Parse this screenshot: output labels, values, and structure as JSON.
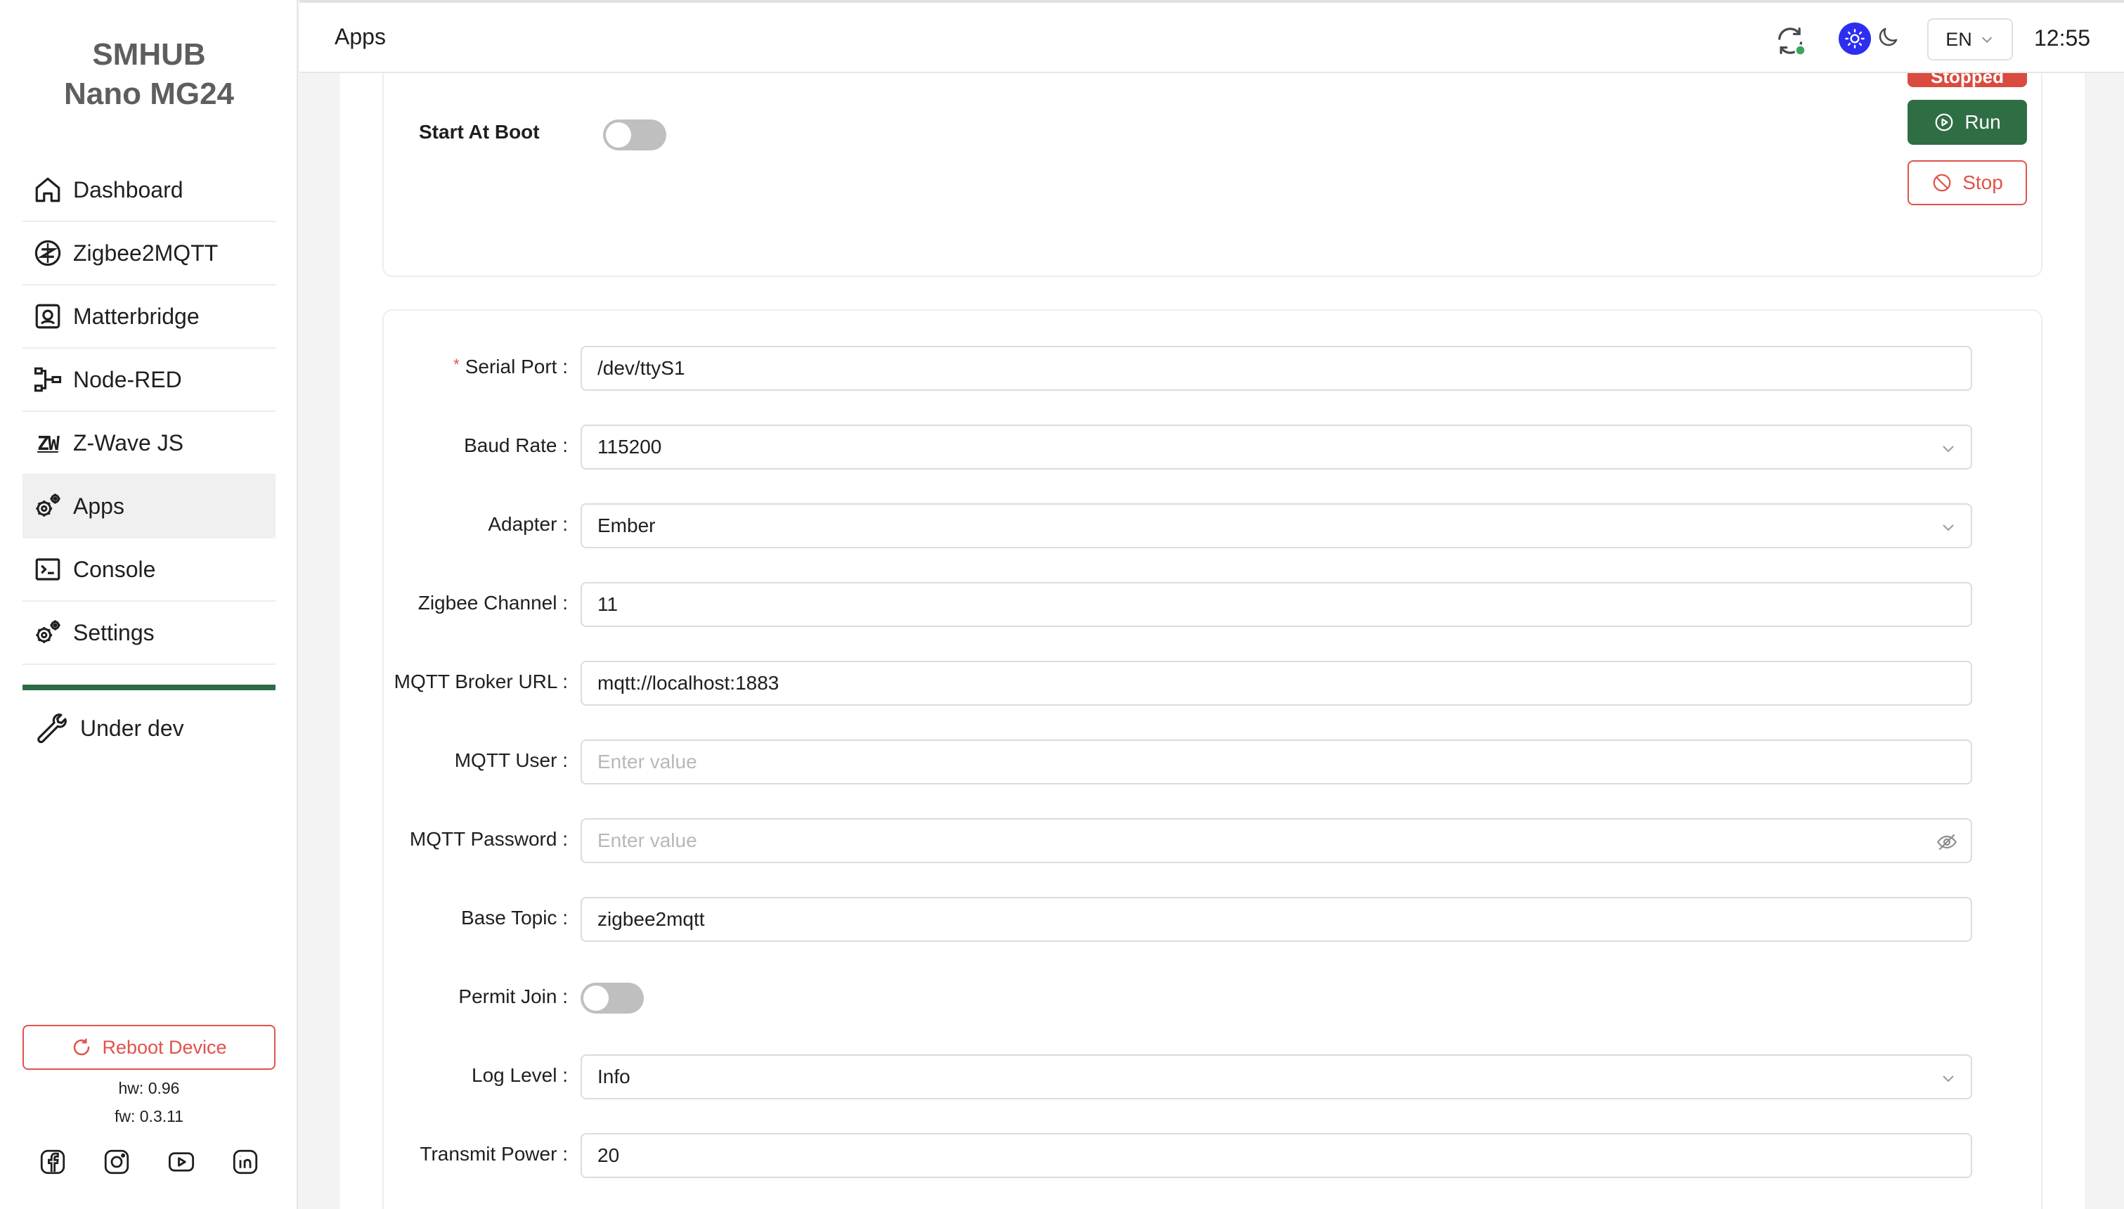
{
  "brand": {
    "line1": "SMHUB",
    "line2": "Nano MG24"
  },
  "sidebar": {
    "items": [
      {
        "label": "Dashboard",
        "icon": "home-icon"
      },
      {
        "label": "Zigbee2MQTT",
        "icon": "zigbee-icon"
      },
      {
        "label": "Matterbridge",
        "icon": "matter-icon"
      },
      {
        "label": "Node-RED",
        "icon": "node-red-icon"
      },
      {
        "label": "Z-Wave JS",
        "icon": "zwave-icon",
        "glyph": "ZW"
      },
      {
        "label": "Apps",
        "icon": "gears-icon",
        "active": true
      },
      {
        "label": "Console",
        "icon": "terminal-icon"
      },
      {
        "label": "Settings",
        "icon": "gears-icon"
      }
    ],
    "under_dev": "Under dev",
    "reboot_label": "Reboot Device",
    "hw": "hw: 0.96",
    "fw": "fw: 0.3.11",
    "social": [
      "facebook-icon",
      "instagram-icon",
      "youtube-icon",
      "linkedin-icon"
    ],
    "accent": "#2e6b45"
  },
  "header": {
    "title": "Apps",
    "lang": "EN",
    "time": "12:55"
  },
  "app_card": {
    "start_at_boot_label": "Start At Boot",
    "start_at_boot": false,
    "status": "Stopped",
    "run_label": "Run",
    "stop_label": "Stop",
    "status_color": "#d94b3f",
    "run_color": "#2f6e45"
  },
  "form": {
    "serial_port": {
      "label": "Serial Port",
      "value": "/dev/ttyS1",
      "required": true
    },
    "baud_rate": {
      "label": "Baud Rate",
      "value": "115200"
    },
    "adapter": {
      "label": "Adapter",
      "value": "Ember"
    },
    "zigbee_channel": {
      "label": "Zigbee Channel",
      "value": "11"
    },
    "mqtt_broker_url": {
      "label": "MQTT Broker URL",
      "value": "mqtt://localhost:1883"
    },
    "mqtt_user": {
      "label": "MQTT User",
      "value": "",
      "placeholder": "Enter value"
    },
    "mqtt_password": {
      "label": "MQTT Password",
      "value": "",
      "placeholder": "Enter value"
    },
    "base_topic": {
      "label": "Base Topic",
      "value": "zigbee2mqtt"
    },
    "permit_join": {
      "label": "Permit Join",
      "value": false
    },
    "log_level": {
      "label": "Log Level",
      "value": "Info"
    },
    "transmit_power": {
      "label": "Transmit Power",
      "value": "20"
    }
  }
}
